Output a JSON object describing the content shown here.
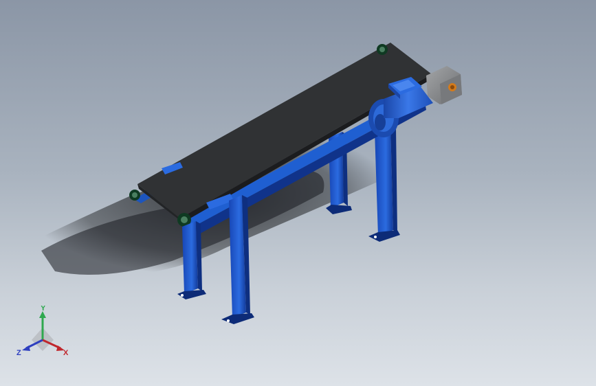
{
  "viewport": {
    "background_top": "#8b96a6",
    "background_bottom": "#dde2e8"
  },
  "model": {
    "frame_color": "#1f5fd1",
    "frame_dark": "#10338a",
    "belt_color": "#303234",
    "motor_color": "#2f68d8",
    "gearbox_color": "#8a8c8e"
  },
  "triad": {
    "x_label": "X",
    "y_label": "Y",
    "z_label": "Z",
    "x_color": "#c0272d",
    "y_color": "#2fa84f",
    "z_color": "#2e3fbf"
  }
}
